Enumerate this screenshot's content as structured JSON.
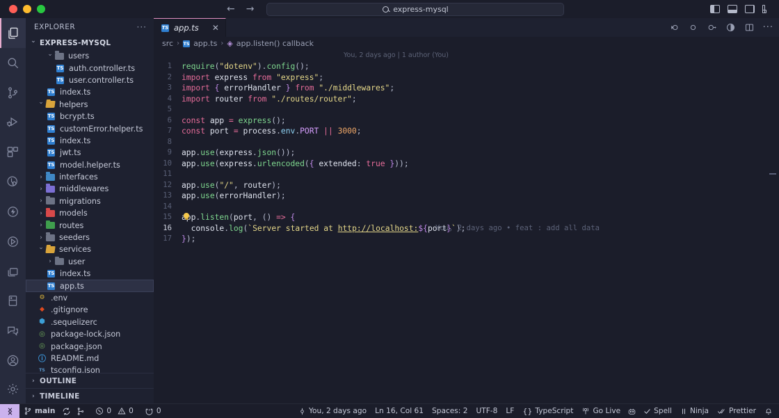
{
  "titlebar": {
    "search_value": "express-mysql",
    "back_icon": "arrow-left-icon",
    "forward_icon": "arrow-right-icon",
    "search_icon": "search-icon",
    "layout_icons": [
      "toggle-primary-sidebar-icon",
      "toggle-panel-icon",
      "toggle-secondary-sidebar-icon",
      "customize-layout-icon"
    ]
  },
  "activitybar": {
    "items": [
      {
        "name": "explorer",
        "icon": "files-icon",
        "active": true
      },
      {
        "name": "search",
        "icon": "search-icon",
        "active": false
      },
      {
        "name": "source-control",
        "icon": "source-control-icon",
        "active": false
      },
      {
        "name": "run-and-debug",
        "icon": "run-debug-icon",
        "active": false
      },
      {
        "name": "extensions",
        "icon": "extensions-icon",
        "active": false
      },
      {
        "name": "testing",
        "icon": "beaker-icon",
        "active": false
      },
      {
        "name": "thunder-client",
        "icon": "lightning-icon",
        "active": false
      },
      {
        "name": "database-client",
        "icon": "database-play-icon",
        "active": false
      },
      {
        "name": "remote-explorer",
        "icon": "remote-window-icon",
        "active": false
      },
      {
        "name": "bookmarks",
        "icon": "book-icon",
        "active": false
      },
      {
        "name": "comments",
        "icon": "comment-icon",
        "active": false
      }
    ],
    "bottom_items": [
      {
        "name": "accounts",
        "icon": "account-icon"
      },
      {
        "name": "settings",
        "icon": "gear-icon"
      }
    ]
  },
  "sidebar": {
    "title": "EXPLORER",
    "more_actions": "···",
    "root_folder": "EXPRESS-MYSQL",
    "tree": [
      {
        "label": "users",
        "kind": "folder",
        "icon": "folder-gray",
        "indent": 2,
        "expanded": true
      },
      {
        "label": "auth.controller.ts",
        "kind": "file",
        "icon": "typescript-icon",
        "indent": 3
      },
      {
        "label": "user.controller.ts",
        "kind": "file",
        "icon": "typescript-icon",
        "indent": 3
      },
      {
        "label": "index.ts",
        "kind": "file",
        "icon": "typescript-icon",
        "indent": 2
      },
      {
        "label": "helpers",
        "kind": "folder",
        "icon": "folder-open-yellow",
        "indent": 1,
        "expanded": true
      },
      {
        "label": "bcrypt.ts",
        "kind": "file",
        "icon": "typescript-icon",
        "indent": 2
      },
      {
        "label": "customError.helper.ts",
        "kind": "file",
        "icon": "typescript-icon",
        "indent": 2
      },
      {
        "label": "index.ts",
        "kind": "file",
        "icon": "typescript-icon",
        "indent": 2
      },
      {
        "label": "jwt.ts",
        "kind": "file",
        "icon": "typescript-icon",
        "indent": 2
      },
      {
        "label": "model.helper.ts",
        "kind": "file",
        "icon": "typescript-icon",
        "indent": 2
      },
      {
        "label": "interfaces",
        "kind": "folder",
        "icon": "folder-blue",
        "indent": 1,
        "expanded": false
      },
      {
        "label": "middlewares",
        "kind": "folder",
        "icon": "folder-purple",
        "indent": 1,
        "expanded": false
      },
      {
        "label": "migrations",
        "kind": "folder",
        "icon": "folder-gray",
        "indent": 1,
        "expanded": false
      },
      {
        "label": "models",
        "kind": "folder",
        "icon": "folder-red",
        "indent": 1,
        "expanded": false
      },
      {
        "label": "routes",
        "kind": "folder",
        "icon": "folder-green",
        "indent": 1,
        "expanded": false
      },
      {
        "label": "seeders",
        "kind": "folder",
        "icon": "folder-gray",
        "indent": 1,
        "expanded": false
      },
      {
        "label": "services",
        "kind": "folder",
        "icon": "folder-open-yellow",
        "indent": 1,
        "expanded": true
      },
      {
        "label": "user",
        "kind": "folder",
        "icon": "folder-gray",
        "indent": 2,
        "expanded": false
      },
      {
        "label": "index.ts",
        "kind": "file",
        "icon": "typescript-icon",
        "indent": 2
      },
      {
        "label": "app.ts",
        "kind": "file",
        "icon": "typescript-icon",
        "indent": 2,
        "selected": true
      },
      {
        "label": ".env",
        "kind": "file",
        "icon": "env-icon",
        "indent": 1
      },
      {
        "label": ".gitignore",
        "kind": "file",
        "icon": "git-icon",
        "indent": 1
      },
      {
        "label": ".sequelizerc",
        "kind": "file",
        "icon": "sequelize-icon",
        "indent": 1
      },
      {
        "label": "package-lock.json",
        "kind": "file",
        "icon": "npm-icon",
        "indent": 1
      },
      {
        "label": "package.json",
        "kind": "file",
        "icon": "npm-icon",
        "indent": 1
      },
      {
        "label": "README.md",
        "kind": "file",
        "icon": "info-icon",
        "indent": 1
      },
      {
        "label": "tsconfig.json",
        "kind": "file",
        "icon": "tsconfig-icon",
        "indent": 1
      }
    ],
    "sections": [
      {
        "label": "OUTLINE",
        "expanded": false
      },
      {
        "label": "TIMELINE",
        "expanded": false
      }
    ]
  },
  "editor": {
    "tab": {
      "label": "app.ts",
      "icon": "typescript-icon",
      "close_icon": "close-icon",
      "dirty": false
    },
    "tab_actions": [
      "split-editor-icon",
      "more-actions-icon"
    ],
    "toolbar_icons": [
      "debug-step-back-icon",
      "debug-pause-icon",
      "debug-step-into-icon",
      "coverage-icon",
      "split-editor-icon",
      "more-actions-icon"
    ],
    "breadcrumb": [
      {
        "label": "src",
        "icon": null
      },
      {
        "label": "app.ts",
        "icon": "typescript-icon"
      },
      {
        "label": "app.listen() callback",
        "icon": "symbol-event-icon"
      }
    ],
    "blame_top": "You, 2 days ago | 1 author (You)",
    "inline_blame": "You, 2 days ago • feat : add all data",
    "cursor_line": 15,
    "current_line": 16,
    "lines": [
      {
        "n": 1,
        "text": "require(\"dotenv\").config();"
      },
      {
        "n": 2,
        "text": "import express from \"express\";"
      },
      {
        "n": 3,
        "text": "import { errorHandler } from \"./middlewares\";"
      },
      {
        "n": 4,
        "text": "import router from \"./routes/router\";"
      },
      {
        "n": 5,
        "text": ""
      },
      {
        "n": 6,
        "text": "const app = express();"
      },
      {
        "n": 7,
        "text": "const port = process.env.PORT || 3000;"
      },
      {
        "n": 8,
        "text": ""
      },
      {
        "n": 9,
        "text": "app.use(express.json());"
      },
      {
        "n": 10,
        "text": "app.use(express.urlencoded({ extended: true }));"
      },
      {
        "n": 11,
        "text": ""
      },
      {
        "n": 12,
        "text": "app.use(\"/\", router);"
      },
      {
        "n": 13,
        "text": "app.use(errorHandler);"
      },
      {
        "n": 14,
        "text": ""
      },
      {
        "n": 15,
        "text": "app.listen(port, () => {"
      },
      {
        "n": 16,
        "text": "  console.log(`Server started at http://localhost:${port}`);"
      },
      {
        "n": 17,
        "text": "});"
      }
    ]
  },
  "statusbar": {
    "remote_icon": "remote-window-icon",
    "left_items": [
      {
        "name": "branch",
        "icon": "source-control-icon",
        "label": "main"
      },
      {
        "name": "sync",
        "icon": "sync-icon",
        "label": ""
      },
      {
        "name": "git-graph",
        "icon": "git-graph-icon",
        "label": ""
      },
      {
        "name": "errors",
        "icon": "error-icon",
        "label": "0"
      },
      {
        "name": "warnings",
        "icon": "warning-icon",
        "label": "0"
      },
      {
        "name": "ports",
        "icon": "ports-icon",
        "label": "0"
      }
    ],
    "right_items": [
      {
        "name": "git-blame",
        "icon": "git-commit-icon",
        "label": "You, 2 days ago"
      },
      {
        "name": "cursor-position",
        "icon": null,
        "label": "Ln 16, Col 61"
      },
      {
        "name": "indentation",
        "icon": null,
        "label": "Spaces: 2"
      },
      {
        "name": "encoding",
        "icon": null,
        "label": "UTF-8"
      },
      {
        "name": "eol",
        "icon": null,
        "label": "LF"
      },
      {
        "name": "language-mode",
        "icon": "braces-icon",
        "label": "TypeScript"
      },
      {
        "name": "go-live",
        "icon": "broadcast-icon",
        "label": "Go Live"
      },
      {
        "name": "ai-assistant",
        "icon": "robot-icon",
        "label": ""
      },
      {
        "name": "spell-checker",
        "icon": "check-icon",
        "label": "Spell"
      },
      {
        "name": "ninja",
        "icon": "pause-icon",
        "label": "Ninja"
      },
      {
        "name": "prettier",
        "icon": "double-check-icon",
        "label": "Prettier"
      },
      {
        "name": "notifications",
        "icon": "bell-icon",
        "label": ""
      }
    ]
  },
  "colors": {
    "accent": "#e28fc0",
    "activity_bg": "#272b3d",
    "sidebar_bg": "#1e2130",
    "editor_bg": "#1b1d2a",
    "remote_badge": "#cbb2ee"
  }
}
